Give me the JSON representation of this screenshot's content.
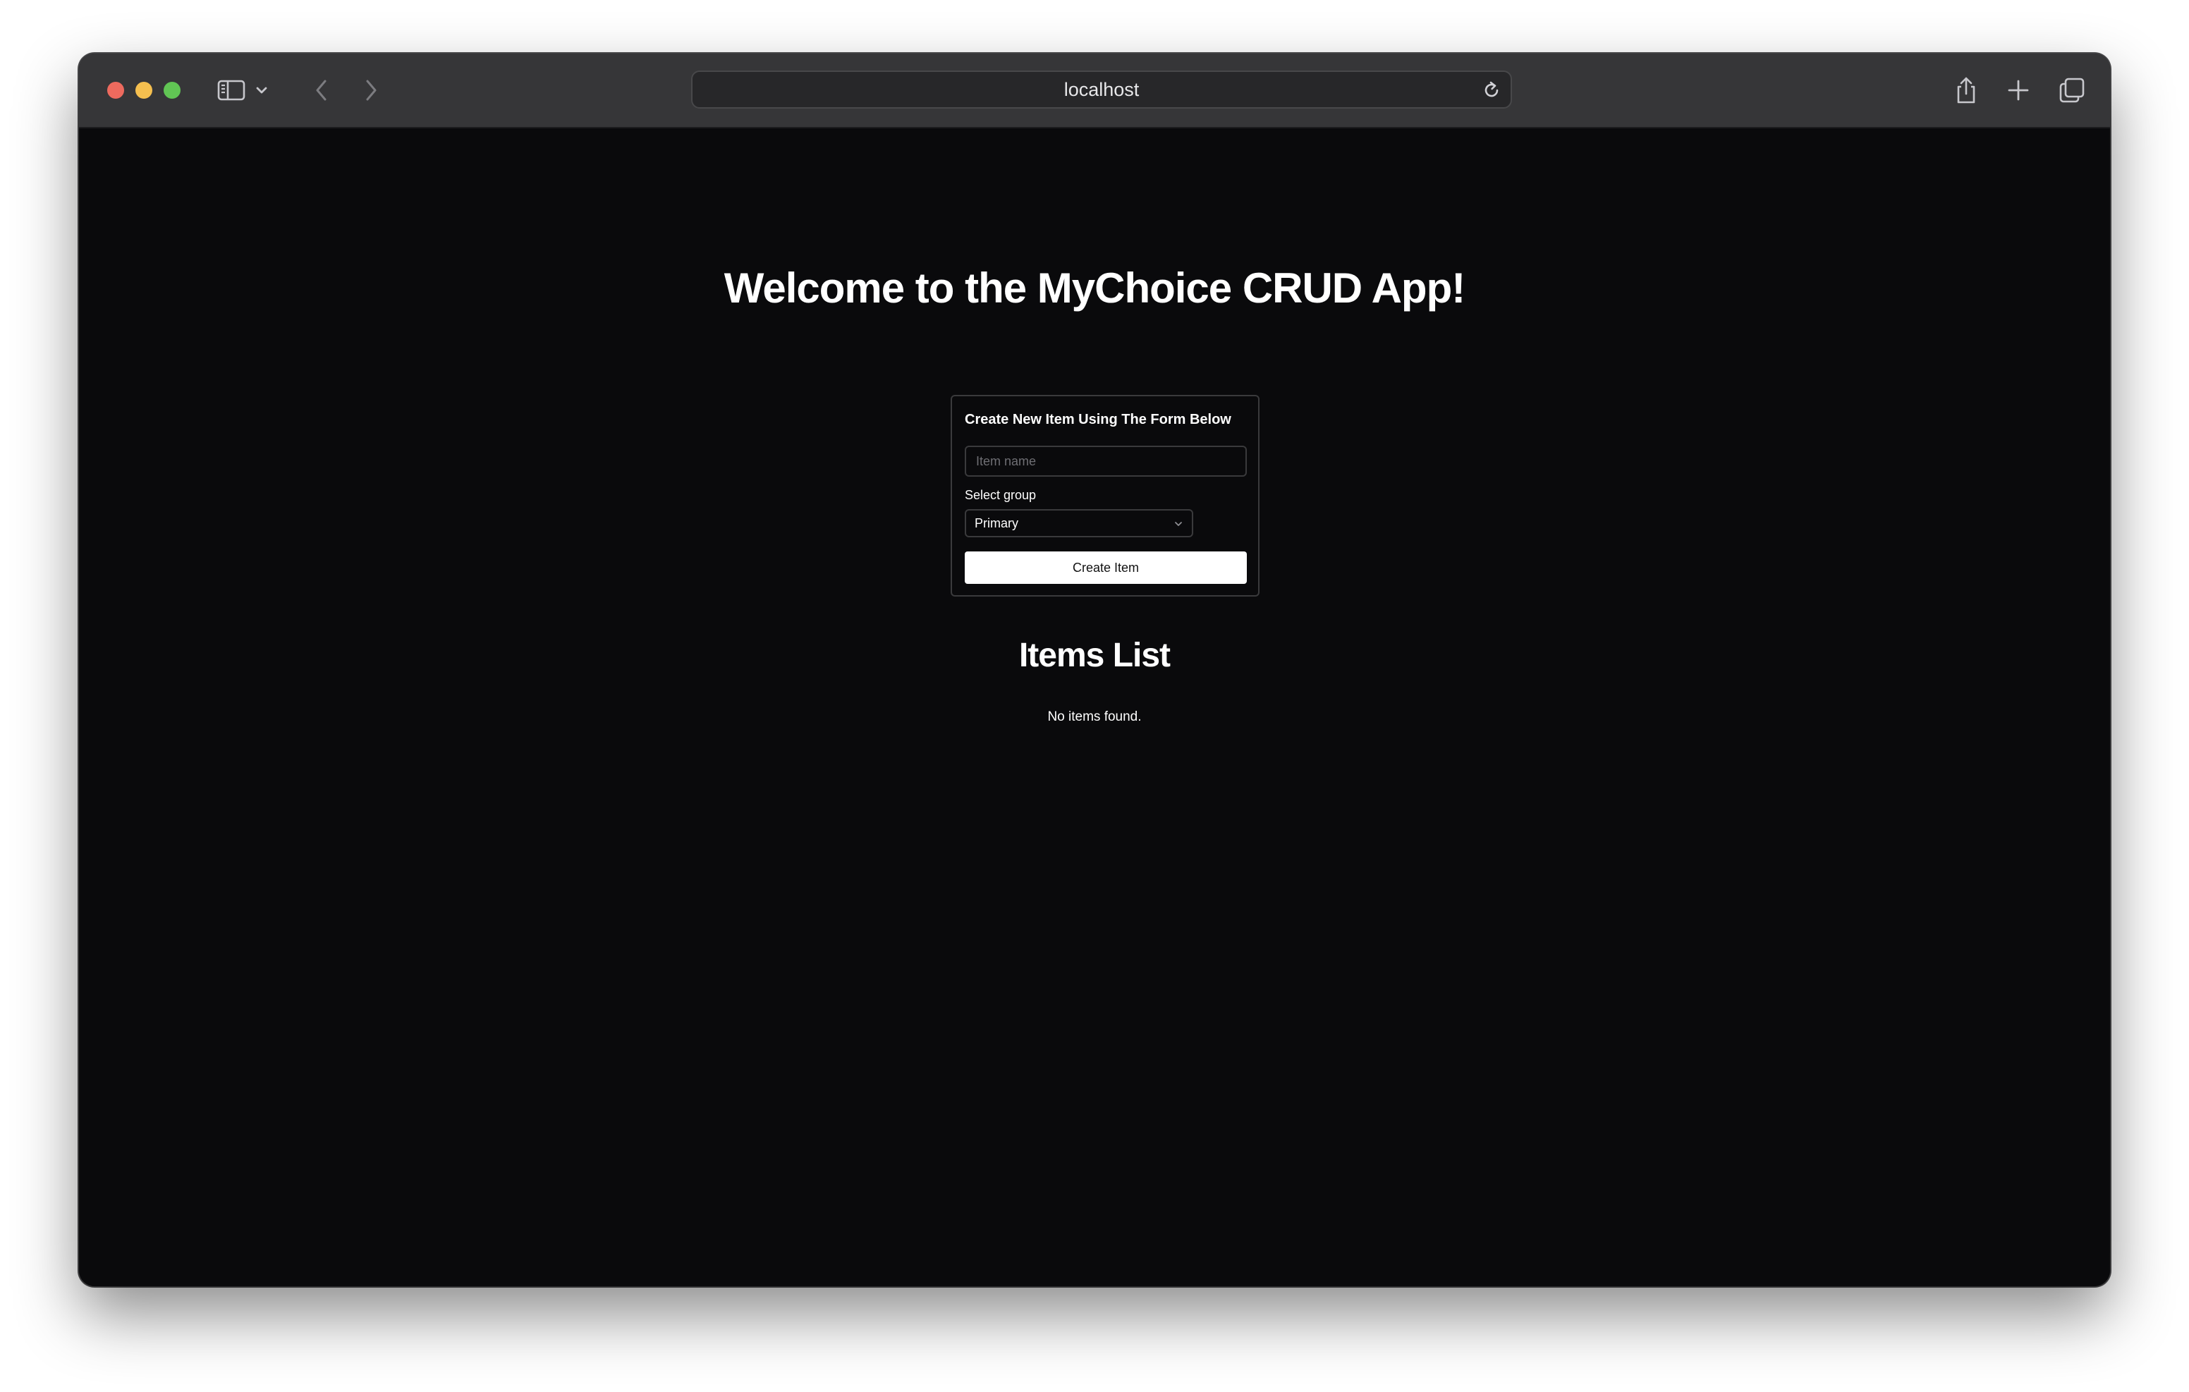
{
  "browser": {
    "url": "localhost",
    "icons": {
      "sidebar": "sidebar-icon",
      "sidebar_menu": "chevron-down-icon",
      "back": "chevron-left-icon",
      "forward": "chevron-right-icon",
      "reload": "reload-icon",
      "share": "share-icon",
      "new_tab": "plus-icon",
      "tab_overview": "tabs-icon"
    }
  },
  "page": {
    "heading": "Welcome to the MyChoice CRUD App!",
    "form": {
      "title": "Create New Item Using The Form Below",
      "item_name_placeholder": "Item name",
      "item_name_value": "",
      "select_label": "Select group",
      "select_value": "Primary",
      "submit_label": "Create Item"
    },
    "list": {
      "heading": "Items List",
      "empty_message": "No items found."
    }
  },
  "colors": {
    "page_background": "#0a0a0c",
    "titlebar": "#363638",
    "text": "#ffffff",
    "button_background": "#ffffff",
    "button_text": "#111111",
    "border": "#3a3a3c"
  }
}
